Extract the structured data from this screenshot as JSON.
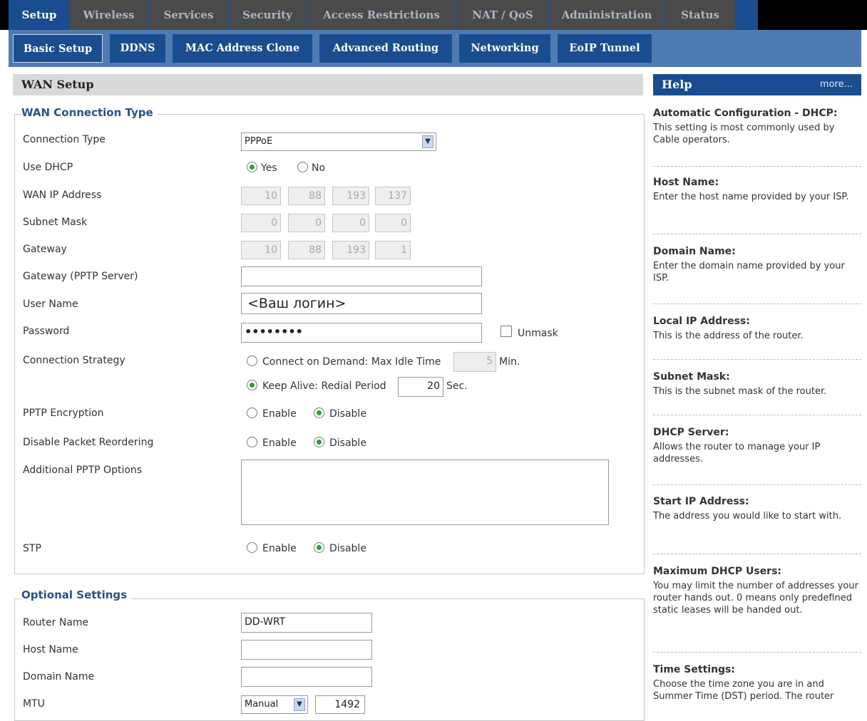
{
  "top_tabs": [
    "Setup",
    "Wireless",
    "Services",
    "Security",
    "Access Restrictions",
    "NAT / QoS",
    "Administration",
    "Status"
  ],
  "sub_tabs": [
    "Basic Setup",
    "DDNS",
    "MAC Address Clone",
    "Advanced Routing",
    "Networking",
    "EoIP Tunnel"
  ],
  "wan_setup": {
    "title": "WAN Setup",
    "legend": "WAN Connection Type",
    "connection_type": {
      "label": "Connection Type",
      "value": "PPPoE"
    },
    "use_dhcp": {
      "label": "Use DHCP",
      "yes": "Yes",
      "no": "No",
      "selected": "Yes"
    },
    "wan_ip": {
      "label": "WAN IP Address",
      "octets": [
        "10",
        "88",
        "193",
        "137"
      ]
    },
    "subnet_mask": {
      "label": "Subnet Mask",
      "octets": [
        "0",
        "0",
        "0",
        "0"
      ]
    },
    "gateway": {
      "label": "Gateway",
      "octets": [
        "10",
        "88",
        "193",
        "1"
      ]
    },
    "gateway_pptp": {
      "label": "Gateway (PPTP Server)",
      "value": ""
    },
    "user_name": {
      "label": "User Name",
      "value": "<Ваш логин>"
    },
    "password": {
      "label": "Password",
      "value": "••••••••",
      "unmask": "Unmask"
    },
    "connection_strategy": {
      "label": "Connection Strategy",
      "connect_on_demand": "Connect on Demand: Max Idle Time",
      "idle_time": "5",
      "idle_unit": "Min.",
      "keep_alive": "Keep Alive: Redial Period",
      "redial_period": "20",
      "redial_unit": "Sec.",
      "selected": "Keep Alive"
    },
    "pptp_encryption": {
      "label": "PPTP Encryption",
      "enable": "Enable",
      "disable": "Disable",
      "selected": "Disable"
    },
    "disable_packet_reordering": {
      "label": "Disable Packet Reordering",
      "enable": "Enable",
      "disable": "Disable",
      "selected": "Disable"
    },
    "additional_pptp_options": {
      "label": "Additional PPTP Options",
      "value": ""
    },
    "stp": {
      "label": "STP",
      "enable": "Enable",
      "disable": "Disable",
      "selected": "Disable"
    }
  },
  "optional_settings": {
    "legend": "Optional Settings",
    "router_name": {
      "label": "Router Name",
      "value": "DD-WRT"
    },
    "host_name": {
      "label": "Host Name",
      "value": ""
    },
    "domain_name": {
      "label": "Domain Name",
      "value": ""
    },
    "mtu": {
      "label": "MTU",
      "mode": "Manual",
      "value": "1492"
    }
  },
  "help": {
    "title": "Help",
    "more": "more...",
    "items": [
      {
        "title": "Automatic Configuration - DHCP:",
        "body": "This setting is most commonly used by Cable operators."
      },
      {
        "title": "Host Name:",
        "body": "Enter the host name provided by your ISP."
      },
      {
        "title": "Domain Name:",
        "body": "Enter the domain name provided by your ISP."
      },
      {
        "title": "Local IP Address:",
        "body": "This is the address of the router."
      },
      {
        "title": "Subnet Mask:",
        "body": "This is the subnet mask of the router."
      },
      {
        "title": "DHCP Server:",
        "body": "Allows the router to manage your IP addresses."
      },
      {
        "title": "Start IP Address:",
        "body": "The address you would like to start with."
      },
      {
        "title": "Maximum DHCP Users:",
        "body": "You may limit the number of addresses your router hands out. 0 means only predefined static leases will be handed out."
      },
      {
        "title": "Time Settings:",
        "body": "Choose the time zone you are in and Summer Time (DST) period. The router"
      }
    ]
  },
  "colors": {
    "tab_blue": "#1a4d8f",
    "subbar_blue": "#4f7bb2",
    "radio_green": "#2e9b3a",
    "legend_blue": "#2a5285"
  }
}
